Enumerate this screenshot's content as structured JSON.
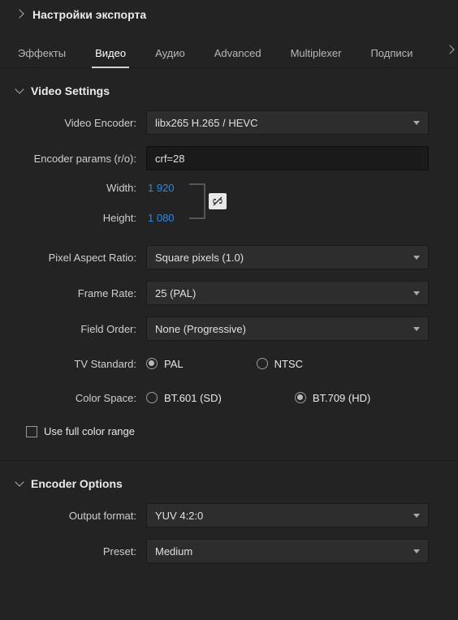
{
  "header": {
    "title": "Настройки экспорта"
  },
  "tabs": {
    "items": [
      {
        "label": "Эффекты"
      },
      {
        "label": "Видео"
      },
      {
        "label": "Аудио"
      },
      {
        "label": "Advanced"
      },
      {
        "label": "Multiplexer"
      },
      {
        "label": "Подписи"
      }
    ],
    "active_index": 1
  },
  "video_settings": {
    "section_title": "Video Settings",
    "encoder_label": "Video Encoder:",
    "encoder_value": "libx265 H.265 / HEVC",
    "params_label": "Encoder params (r/o):",
    "params_value": "crf=28",
    "width_label": "Width:",
    "width_value": "1 920",
    "height_label": "Height:",
    "height_value": "1 080",
    "par_label": "Pixel Aspect Ratio:",
    "par_value": "Square pixels (1.0)",
    "framerate_label": "Frame Rate:",
    "framerate_value": "25 (PAL)",
    "field_order_label": "Field Order:",
    "field_order_value": "None (Progressive)",
    "tv_standard_label": "TV Standard:",
    "tv_standard": {
      "pal": "PAL",
      "ntsc": "NTSC",
      "selected": "PAL"
    },
    "color_space_label": "Color Space:",
    "color_space": {
      "bt601": "BT.601 (SD)",
      "bt709": "BT.709 (HD)",
      "selected": "BT.709"
    },
    "full_color_label": "Use full color range",
    "full_color_checked": false
  },
  "encoder_options": {
    "section_title": "Encoder Options",
    "output_format_label": "Output format:",
    "output_format_value": "YUV 4:2:0",
    "preset_label": "Preset:",
    "preset_value": "Medium"
  }
}
